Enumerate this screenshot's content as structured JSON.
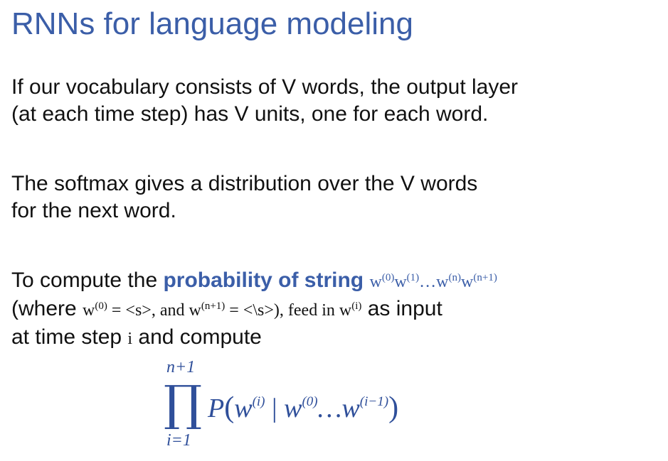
{
  "title": "RNNs for language modeling",
  "p1": {
    "line1": "If our vocabulary consists of V words, the output layer",
    "line2": "(at each time step) has V units, one for each word."
  },
  "p2": {
    "line1": "The softmax gives a distribution over the V words",
    "line2": "for the next word."
  },
  "p3": {
    "prefix": "To compute the ",
    "highlight": "probability of  string",
    "w_seq": {
      "w1": "w",
      "s1": "(0)",
      "w2": "w",
      "s2": "(1)",
      "dots": "…",
      "w3": "w",
      "s3": "(n)",
      "w4": "w",
      "s4": "(n+1)"
    },
    "line2_a": "(where ",
    "line2_w0": "w",
    "line2_s0": "(0)",
    "line2_eq1": " = <s>, and ",
    "line2_wn": "w",
    "line2_sn": "(n+1)",
    "line2_eq2": " = <\\s>), feed in ",
    "line2_wi": "w",
    "line2_si": "(i)",
    "line2_end": " as input",
    "line3_a": "at time step ",
    "line3_i": "i",
    "line3_b": " and compute"
  },
  "formula": {
    "upper": "n+1",
    "product": "∏",
    "lower": "i=1",
    "P": "P",
    "open": "(",
    "w_a": "w",
    "sup_a": "(i)",
    "bar": " | ",
    "w_b": "w",
    "sup_b": "(0)",
    "dots": "…",
    "w_c": "w",
    "sup_c": "(i−1)",
    "close": ")"
  }
}
